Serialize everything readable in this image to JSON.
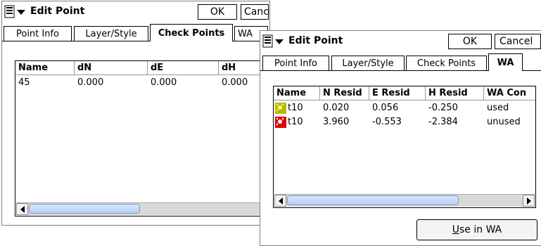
{
  "left_window": {
    "title": "Edit Point",
    "ok_label": "OK",
    "cancel_label": "Cancel",
    "tabs": [
      "Point Info",
      "Layer/Style",
      "Check Points",
      "WA"
    ],
    "active_tab": "Check Points",
    "columns": [
      "Name",
      "dN",
      "dE",
      "dH"
    ],
    "rows": [
      {
        "name": "45",
        "dN": "0.000",
        "dE": "0.000",
        "dH": "0.000"
      }
    ]
  },
  "right_window": {
    "title": "Edit Point",
    "ok_label": "OK",
    "cancel_label": "Cancel",
    "tabs": [
      "Point Info",
      "Layer/Style",
      "Check Points",
      "WA"
    ],
    "active_tab": "WA",
    "columns": [
      "Name",
      "N Resid",
      "E Resid",
      "H Resid",
      "WA Con"
    ],
    "rows": [
      {
        "icon": "used-point-icon",
        "icon_color": "#c8c800",
        "name": "t10",
        "n": "0.020",
        "e": "0.056",
        "h": "-0.250",
        "wa": "used"
      },
      {
        "icon": "unused-point-icon",
        "icon_color": "#e00000",
        "name": "t10",
        "n": "3.960",
        "e": "-0.553",
        "h": "-2.384",
        "wa": "unused"
      }
    ],
    "use_button": {
      "prefix": "U",
      "rest": "se in WA"
    }
  },
  "icons": {
    "menu": "menu-dropdown-icon",
    "scroll_left": "scroll-left-arrow-icon",
    "scroll_right": "scroll-right-arrow-icon"
  }
}
